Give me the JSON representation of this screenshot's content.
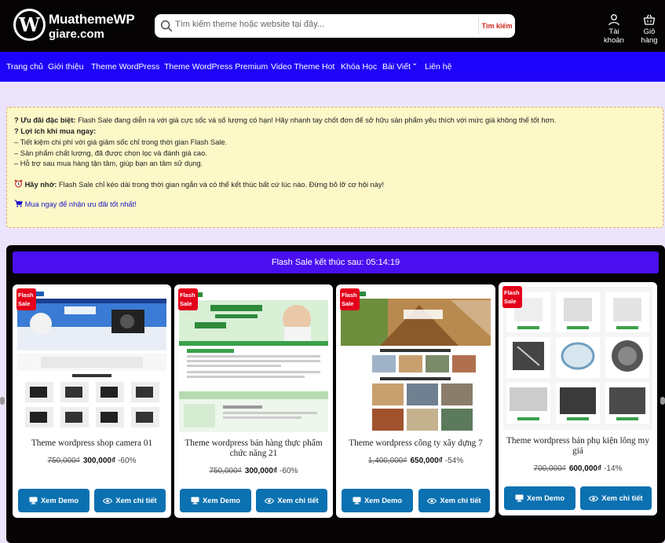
{
  "header": {
    "logo_line1": "MuathemeWP",
    "logo_line2": "giare.com",
    "logo_glyph": "W",
    "search_placeholder": "Tìm kiếm theme hoặc website tại đây...",
    "search_button": "Tìm kiếm",
    "account_label": "Tài khoản",
    "cart_label": "Giỏ hàng"
  },
  "nav": {
    "items": [
      "Trang chủ",
      "Giới thiệu",
      "Theme WordPress",
      "Theme WordPress Premium",
      "Video Theme Hot",
      "Khóa Học",
      "Bài Viết",
      "Liên hệ"
    ],
    "dropdown_chevron": "⌄"
  },
  "notice": {
    "offer_prefix": "? Ưu đãi đặc biệt:",
    "offer_text": " Flash Sale đang diễn ra với giá cực sốc và số lượng có hạn! Hãy nhanh tay chốt đơn để sở hữu sản phẩm yêu thích với mức giá không thể tốt hơn.",
    "benefit_title": "? Lợi ích khi mua ngay:",
    "benefits": [
      "– Tiết kiệm chi phí với giá giảm sốc chỉ trong thời gian Flash Sale.",
      "– Sản phẩm chất lượng, đã được chọn lọc và đánh giá cao.",
      "– Hỗ trợ sau mua hàng tận tâm, giúp bạn an tâm sử dụng."
    ],
    "remind_prefix": "Hãy nhớ:",
    "remind_text": " Flash Sale chỉ kéo dài trong thời gian ngắn và có thể kết thúc bất cứ lúc nào. Đừng bỏ lỡ cơ hội này!",
    "cta": "Mua ngay để nhận ưu đãi tốt nhất!"
  },
  "flash": {
    "timer_label": "Flash Sale kết thúc sau: 05:14:19",
    "badge_text": "Flash Sale",
    "demo_label": "Xem Demo",
    "detail_label": "Xem chi tiết",
    "products": [
      {
        "title": "Theme wordpress shop camera 01",
        "old_price": "750,000₫",
        "new_price": "300,000₫",
        "discount": "-60%"
      },
      {
        "title": "Theme wordpress bán hàng thực phẩm chức năng 21",
        "old_price": "750,000₫",
        "new_price": "300,000₫",
        "discount": "-60%"
      },
      {
        "title": "Theme wordpress công ty xây dựng 7",
        "old_price": "1,400,000₫",
        "new_price": "650,000₫",
        "discount": "-54%"
      },
      {
        "title": "Theme wordpress bán phụ kiện lông my giả",
        "old_price": "700,000₫",
        "new_price": "600,000₫",
        "discount": "-14%"
      }
    ]
  },
  "colors": {
    "header_bg": "#060304",
    "nav_bg": "#1e03fa",
    "timer_bg": "#4a0ff0",
    "button_bg": "#0c71b1",
    "badge_bg": "#e4001b",
    "notice_bg": "#fdf8c8"
  },
  "icons": {
    "search": "search-icon",
    "account": "user-icon",
    "cart": "basket-icon",
    "alarm": "alarm-clock-icon",
    "cart_small": "cart-icon",
    "monitor": "monitor-icon",
    "eye": "eye-icon"
  }
}
